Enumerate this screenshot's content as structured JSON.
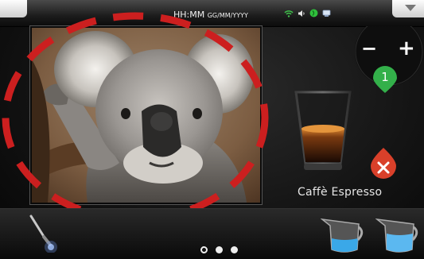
{
  "status_bar": {
    "time": "HH:MM",
    "date": "GG/MM/YYYY",
    "icons": [
      "wifi-icon",
      "speaker-icon",
      "bean-icon",
      "usb-icon"
    ],
    "menu_icon": "chevron-down-icon"
  },
  "photo": {
    "annotation_color": "#cc1f1f"
  },
  "stepper": {
    "minus": "−",
    "plus": "+",
    "count": "1",
    "badge_color": "#33b04a"
  },
  "beverage": {
    "name": "Caffè Espresso",
    "cancel_icon": "close-icon",
    "cancel_color": "#d9402a"
  },
  "bottom_bar": {
    "left_icon": "steam-wand-icon",
    "right_icons": [
      "milk-pitcher-icon",
      "hot-water-pitcher-icon"
    ],
    "page_dots": [
      {
        "state": "active"
      },
      {
        "state": "inactive"
      },
      {
        "state": "inactive"
      }
    ]
  }
}
